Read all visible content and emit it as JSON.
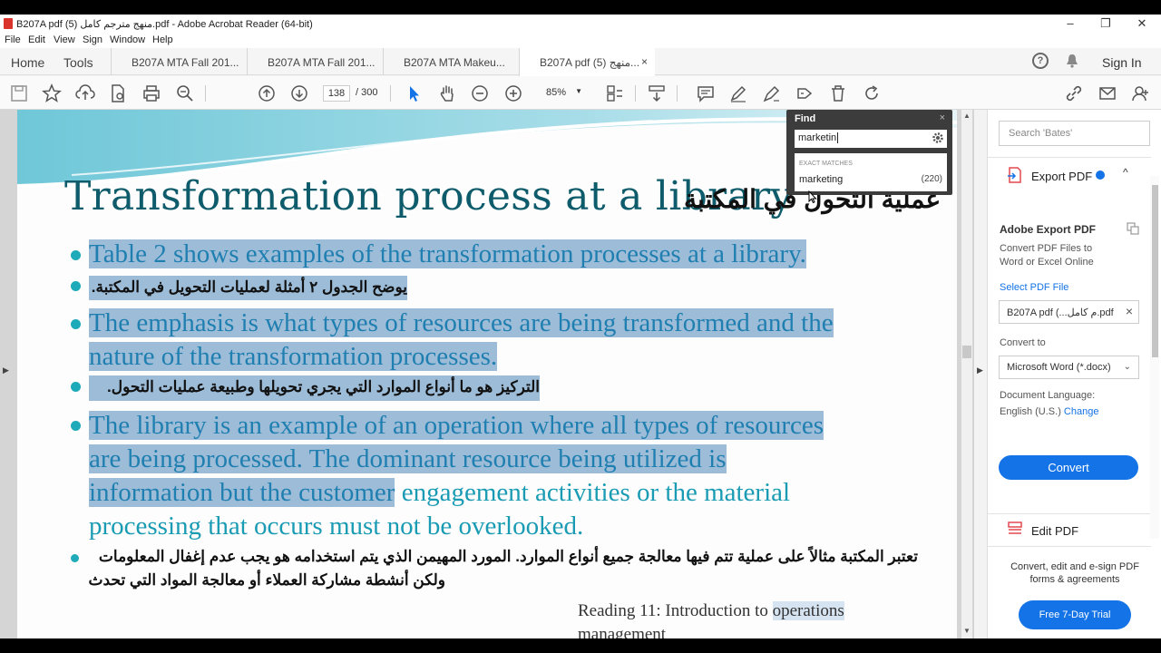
{
  "window": {
    "title": "B207A pdf (5) منهج مترجم كامل.pdf - Adobe Acrobat Reader (64-bit)",
    "minimize": "–",
    "maximize": "❐",
    "close": "✕"
  },
  "menu": [
    "File",
    "Edit",
    "View",
    "Sign",
    "Window",
    "Help"
  ],
  "nav": {
    "home": "Home",
    "tools": "Tools",
    "tabs": [
      {
        "label": "B207A MTA Fall 201..."
      },
      {
        "label": "B207A MTA Fall 201..."
      },
      {
        "label": "B207A MTA Makeu..."
      },
      {
        "label": "B207A pdf (5) منهج...",
        "close": "×"
      }
    ],
    "help": "?",
    "signin": "Sign In"
  },
  "toolbar": {
    "page_current": "138",
    "page_total": "/ 300",
    "zoom": "85%",
    "zoom_dropdown": "▼"
  },
  "document": {
    "title_en": "Transformation process at a library",
    "title_ar": "عملية التحول في المكتبة",
    "para1_en": "Table 2 shows examples of the transformation processes at a library.",
    "para1_ar": "يوضح الجدول ٢ أمثلة لعمليات التحويل في المكتبة.",
    "para2_en_l1": "The emphasis is what types of resources are being transformed and the",
    "para2_en_l2": "nature of the transformation processes.",
    "para2_ar": "التركيز هو ما أنواع الموارد التي يجري تحويلها وطبيعة عمليات التحول.",
    "para3_en_l1": "The library is an example of an operation where all types of resources",
    "para3_en_l2": "are being processed. The dominant resource being utilized is",
    "para3_en_l3a": "information but the customer",
    "para3_en_l3b": " engagement activities or the material",
    "para3_en_l4": "processing that occurs must not be overlooked.",
    "para3_ar_l1": "تعتبر المكتبة مثالاً على عملية تتم فيها معالجة جميع أنواع الموارد. المورد المهيمن الذي يتم استخدامه هو يجب عدم إغفال المعلومات",
    "para3_ar_l2": "ولكن أنشطة مشاركة العملاء أو معالجة المواد التي تحدث",
    "footer_a": "Reading 11: Introduction to ",
    "footer_b": "operations",
    "footer_c": "management"
  },
  "find": {
    "title": "Find",
    "close": "×",
    "query": "marketin",
    "section": "EXACT MATCHES",
    "match": "marketing",
    "count": "(220)"
  },
  "panel": {
    "search_placeholder": "Search 'Bates'",
    "export_title": "Export PDF",
    "collapse": "^",
    "heading": "Adobe Export PDF",
    "desc": "Convert PDF Files to Word or Excel Online",
    "select_label": "Select PDF File",
    "file_name": "B207A pdf (...م كامل.pdf",
    "file_remove": "×",
    "convert_to_label": "Convert to",
    "convert_to_value": "Microsoft Word (*.docx)",
    "dropdown": "⌄",
    "lang_label": "Document Language:",
    "lang_value": "English (U.S.)",
    "lang_change": "Change",
    "convert_btn": "Convert",
    "edit_title": "Edit PDF",
    "promo": "Convert, edit and e-sign PDF forms & agreements",
    "trial_btn": "Free 7-Day Trial"
  },
  "colors": {
    "accent": "#1473e6",
    "text_teal": "#1a9bb4",
    "title_teal": "#0e5c6b",
    "highlight": "#9dbcd8"
  }
}
